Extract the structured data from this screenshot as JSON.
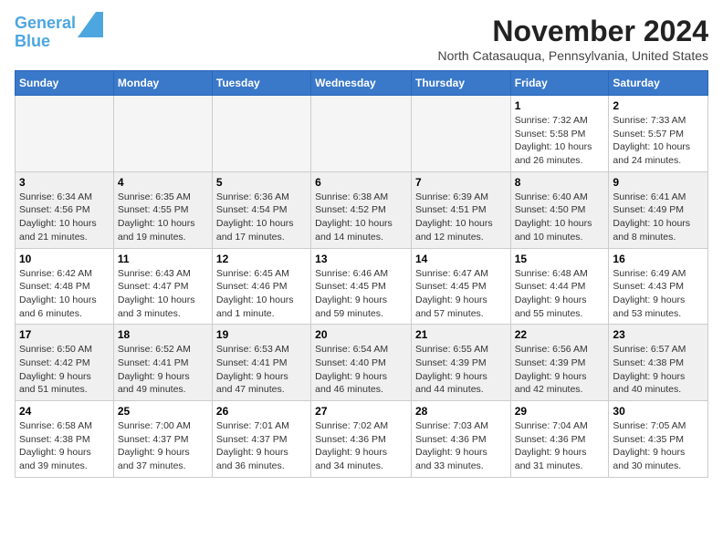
{
  "logo": {
    "line1": "General",
    "line2": "Blue"
  },
  "title": "November 2024",
  "location": "North Catasauqua, Pennsylvania, United States",
  "days_of_week": [
    "Sunday",
    "Monday",
    "Tuesday",
    "Wednesday",
    "Thursday",
    "Friday",
    "Saturday"
  ],
  "weeks": [
    [
      {
        "day": "",
        "info": "",
        "empty": true
      },
      {
        "day": "",
        "info": "",
        "empty": true
      },
      {
        "day": "",
        "info": "",
        "empty": true
      },
      {
        "day": "",
        "info": "",
        "empty": true
      },
      {
        "day": "",
        "info": "",
        "empty": true
      },
      {
        "day": "1",
        "info": "Sunrise: 7:32 AM\nSunset: 5:58 PM\nDaylight: 10 hours\nand 26 minutes."
      },
      {
        "day": "2",
        "info": "Sunrise: 7:33 AM\nSunset: 5:57 PM\nDaylight: 10 hours\nand 24 minutes."
      }
    ],
    [
      {
        "day": "3",
        "info": "Sunrise: 6:34 AM\nSunset: 4:56 PM\nDaylight: 10 hours\nand 21 minutes."
      },
      {
        "day": "4",
        "info": "Sunrise: 6:35 AM\nSunset: 4:55 PM\nDaylight: 10 hours\nand 19 minutes."
      },
      {
        "day": "5",
        "info": "Sunrise: 6:36 AM\nSunset: 4:54 PM\nDaylight: 10 hours\nand 17 minutes."
      },
      {
        "day": "6",
        "info": "Sunrise: 6:38 AM\nSunset: 4:52 PM\nDaylight: 10 hours\nand 14 minutes."
      },
      {
        "day": "7",
        "info": "Sunrise: 6:39 AM\nSunset: 4:51 PM\nDaylight: 10 hours\nand 12 minutes."
      },
      {
        "day": "8",
        "info": "Sunrise: 6:40 AM\nSunset: 4:50 PM\nDaylight: 10 hours\nand 10 minutes."
      },
      {
        "day": "9",
        "info": "Sunrise: 6:41 AM\nSunset: 4:49 PM\nDaylight: 10 hours\nand 8 minutes."
      }
    ],
    [
      {
        "day": "10",
        "info": "Sunrise: 6:42 AM\nSunset: 4:48 PM\nDaylight: 10 hours\nand 6 minutes."
      },
      {
        "day": "11",
        "info": "Sunrise: 6:43 AM\nSunset: 4:47 PM\nDaylight: 10 hours\nand 3 minutes."
      },
      {
        "day": "12",
        "info": "Sunrise: 6:45 AM\nSunset: 4:46 PM\nDaylight: 10 hours\nand 1 minute."
      },
      {
        "day": "13",
        "info": "Sunrise: 6:46 AM\nSunset: 4:45 PM\nDaylight: 9 hours\nand 59 minutes."
      },
      {
        "day": "14",
        "info": "Sunrise: 6:47 AM\nSunset: 4:45 PM\nDaylight: 9 hours\nand 57 minutes."
      },
      {
        "day": "15",
        "info": "Sunrise: 6:48 AM\nSunset: 4:44 PM\nDaylight: 9 hours\nand 55 minutes."
      },
      {
        "day": "16",
        "info": "Sunrise: 6:49 AM\nSunset: 4:43 PM\nDaylight: 9 hours\nand 53 minutes."
      }
    ],
    [
      {
        "day": "17",
        "info": "Sunrise: 6:50 AM\nSunset: 4:42 PM\nDaylight: 9 hours\nand 51 minutes."
      },
      {
        "day": "18",
        "info": "Sunrise: 6:52 AM\nSunset: 4:41 PM\nDaylight: 9 hours\nand 49 minutes."
      },
      {
        "day": "19",
        "info": "Sunrise: 6:53 AM\nSunset: 4:41 PM\nDaylight: 9 hours\nand 47 minutes."
      },
      {
        "day": "20",
        "info": "Sunrise: 6:54 AM\nSunset: 4:40 PM\nDaylight: 9 hours\nand 46 minutes."
      },
      {
        "day": "21",
        "info": "Sunrise: 6:55 AM\nSunset: 4:39 PM\nDaylight: 9 hours\nand 44 minutes."
      },
      {
        "day": "22",
        "info": "Sunrise: 6:56 AM\nSunset: 4:39 PM\nDaylight: 9 hours\nand 42 minutes."
      },
      {
        "day": "23",
        "info": "Sunrise: 6:57 AM\nSunset: 4:38 PM\nDaylight: 9 hours\nand 40 minutes."
      }
    ],
    [
      {
        "day": "24",
        "info": "Sunrise: 6:58 AM\nSunset: 4:38 PM\nDaylight: 9 hours\nand 39 minutes."
      },
      {
        "day": "25",
        "info": "Sunrise: 7:00 AM\nSunset: 4:37 PM\nDaylight: 9 hours\nand 37 minutes."
      },
      {
        "day": "26",
        "info": "Sunrise: 7:01 AM\nSunset: 4:37 PM\nDaylight: 9 hours\nand 36 minutes."
      },
      {
        "day": "27",
        "info": "Sunrise: 7:02 AM\nSunset: 4:36 PM\nDaylight: 9 hours\nand 34 minutes."
      },
      {
        "day": "28",
        "info": "Sunrise: 7:03 AM\nSunset: 4:36 PM\nDaylight: 9 hours\nand 33 minutes."
      },
      {
        "day": "29",
        "info": "Sunrise: 7:04 AM\nSunset: 4:36 PM\nDaylight: 9 hours\nand 31 minutes."
      },
      {
        "day": "30",
        "info": "Sunrise: 7:05 AM\nSunset: 4:35 PM\nDaylight: 9 hours\nand 30 minutes."
      }
    ]
  ]
}
